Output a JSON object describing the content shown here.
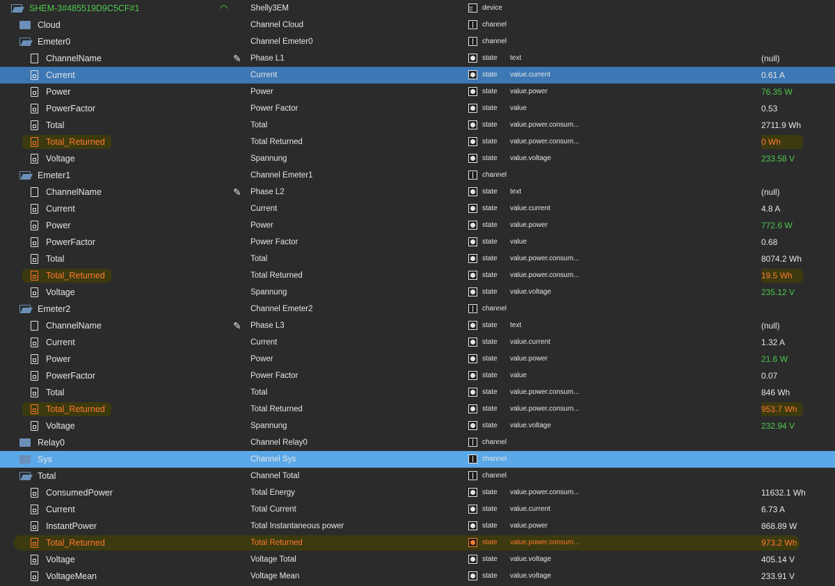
{
  "rows": [
    {
      "indent": 0,
      "icon": "folder-open",
      "name": "SHEM-3#485519D9C5CF#1",
      "name_color": "green",
      "wifi": true,
      "display": "Shelly3EM",
      "type": "device",
      "type_label": "device",
      "role": "",
      "value": ""
    },
    {
      "indent": 1,
      "icon": "folder",
      "name": "Cloud",
      "display": "Channel Cloud",
      "type": "channel",
      "type_label": "channel",
      "role": "",
      "value": ""
    },
    {
      "indent": 1,
      "icon": "folder-open",
      "name": "Emeter0",
      "display": "Channel Emeter0",
      "type": "channel",
      "type_label": "channel",
      "role": "",
      "value": ""
    },
    {
      "indent": 2,
      "icon": "doc",
      "name": "ChannelName",
      "edit": true,
      "display": "Phase L1",
      "type": "state",
      "type_label": "state",
      "role": "text",
      "value": "(null)"
    },
    {
      "indent": 2,
      "icon": "doc-state",
      "name": "Current",
      "selected": "blue",
      "display": "Current",
      "type": "state",
      "type_label": "state",
      "role": "value.current",
      "value": "0.61 A"
    },
    {
      "indent": 2,
      "icon": "doc-state",
      "name": "Power",
      "display": "Power",
      "type": "state",
      "type_label": "state",
      "role": "value.power",
      "value": "76.35 W",
      "value_color": "green"
    },
    {
      "indent": 2,
      "icon": "doc-state",
      "name": "PowerFactor",
      "display": "Power Factor",
      "type": "state",
      "type_label": "state",
      "role": "value",
      "value": "0.53"
    },
    {
      "indent": 2,
      "icon": "doc-state",
      "name": "Total",
      "display": "Total",
      "type": "state",
      "type_label": "state",
      "role": "value.power.consum...",
      "value": "2711.9 Wh"
    },
    {
      "indent": 2,
      "icon": "doc-ret",
      "name": "Total_Returned",
      "returned": true,
      "display": "Total Returned",
      "type": "state",
      "type_label": "state",
      "role": "value.power.consum...",
      "value": "0 Wh",
      "value_color": "orange",
      "value_hl": true
    },
    {
      "indent": 2,
      "icon": "doc-state",
      "name": "Voltage",
      "display": "Spannung",
      "type": "state",
      "type_label": "state",
      "role": "value.voltage",
      "value": "233.58 V",
      "value_color": "green"
    },
    {
      "indent": 1,
      "icon": "folder-open",
      "name": "Emeter1",
      "display": "Channel Emeter1",
      "type": "channel",
      "type_label": "channel",
      "role": "",
      "value": ""
    },
    {
      "indent": 2,
      "icon": "doc",
      "name": "ChannelName",
      "edit": true,
      "display": "Phase L2",
      "type": "state",
      "type_label": "state",
      "role": "text",
      "value": "(null)"
    },
    {
      "indent": 2,
      "icon": "doc-state",
      "name": "Current",
      "display": "Current",
      "type": "state",
      "type_label": "state",
      "role": "value.current",
      "value": "4.8 A"
    },
    {
      "indent": 2,
      "icon": "doc-state",
      "name": "Power",
      "display": "Power",
      "type": "state",
      "type_label": "state",
      "role": "value.power",
      "value": "772.6 W",
      "value_color": "green"
    },
    {
      "indent": 2,
      "icon": "doc-state",
      "name": "PowerFactor",
      "display": "Power Factor",
      "type": "state",
      "type_label": "state",
      "role": "value",
      "value": "0.68"
    },
    {
      "indent": 2,
      "icon": "doc-state",
      "name": "Total",
      "display": "Total",
      "type": "state",
      "type_label": "state",
      "role": "value.power.consum...",
      "value": "8074.2 Wh"
    },
    {
      "indent": 2,
      "icon": "doc-ret",
      "name": "Total_Returned",
      "returned": true,
      "display": "Total Returned",
      "type": "state",
      "type_label": "state",
      "role": "value.power.consum...",
      "value": "19.5 Wh",
      "value_color": "orange",
      "value_hl": true
    },
    {
      "indent": 2,
      "icon": "doc-state",
      "name": "Voltage",
      "display": "Spannung",
      "type": "state",
      "type_label": "state",
      "role": "value.voltage",
      "value": "235.12 V",
      "value_color": "green"
    },
    {
      "indent": 1,
      "icon": "folder-open",
      "name": "Emeter2",
      "display": "Channel Emeter2",
      "type": "channel",
      "type_label": "channel",
      "role": "",
      "value": ""
    },
    {
      "indent": 2,
      "icon": "doc",
      "name": "ChannelName",
      "edit": true,
      "display": "Phase L3",
      "type": "state",
      "type_label": "state",
      "role": "text",
      "value": "(null)"
    },
    {
      "indent": 2,
      "icon": "doc-state",
      "name": "Current",
      "display": "Current",
      "type": "state",
      "type_label": "state",
      "role": "value.current",
      "value": "1.32 A"
    },
    {
      "indent": 2,
      "icon": "doc-state",
      "name": "Power",
      "display": "Power",
      "type": "state",
      "type_label": "state",
      "role": "value.power",
      "value": "21.6 W",
      "value_color": "green"
    },
    {
      "indent": 2,
      "icon": "doc-state",
      "name": "PowerFactor",
      "display": "Power Factor",
      "type": "state",
      "type_label": "state",
      "role": "value",
      "value": "0.07"
    },
    {
      "indent": 2,
      "icon": "doc-state",
      "name": "Total",
      "display": "Total",
      "type": "state",
      "type_label": "state",
      "role": "value.power.consum...",
      "value": "846 Wh"
    },
    {
      "indent": 2,
      "icon": "doc-ret",
      "name": "Total_Returned",
      "returned": true,
      "display": "Total Returned",
      "type": "state",
      "type_label": "state",
      "role": "value.power.consum...",
      "value": "953.7 Wh",
      "value_color": "orange",
      "value_hl": true
    },
    {
      "indent": 2,
      "icon": "doc-state",
      "name": "Voltage",
      "display": "Spannung",
      "type": "state",
      "type_label": "state",
      "role": "value.voltage",
      "value": "232.94 V",
      "value_color": "green"
    },
    {
      "indent": 1,
      "icon": "folder",
      "name": "Relay0",
      "display": "Channel Relay0",
      "type": "channel",
      "type_label": "channel",
      "role": "",
      "value": ""
    },
    {
      "indent": 1,
      "icon": "folder",
      "name": "Sys",
      "selected": "light",
      "display": "Channel Sys",
      "type": "channel",
      "type_label": "channel",
      "role": "",
      "value": ""
    },
    {
      "indent": 1,
      "icon": "folder-open",
      "name": "Total",
      "display": "Channel Total",
      "type": "channel",
      "type_label": "channel",
      "role": "",
      "value": ""
    },
    {
      "indent": 2,
      "icon": "doc-state",
      "name": "ConsumedPower",
      "display": "Total Energy",
      "type": "state",
      "type_label": "state",
      "role": "value.power.consum...",
      "value": "11632.1 Wh"
    },
    {
      "indent": 2,
      "icon": "doc-state",
      "name": "Current",
      "display": "Total Current",
      "type": "state",
      "type_label": "state",
      "role": "value.current",
      "value": "6.73 A"
    },
    {
      "indent": 2,
      "icon": "doc-state",
      "name": "InstantPower",
      "display": "Total Instantaneous power",
      "type": "state",
      "type_label": "state",
      "role": "value.power",
      "value": "868.89 W"
    },
    {
      "indent": 2,
      "icon": "doc-ret",
      "name": "Total_Returned",
      "returned": true,
      "row_band": true,
      "display": "Total Returned",
      "type": "state",
      "type_label": "state",
      "role": "value.power.consum...",
      "value": "973.2 Wh",
      "value_color": "orange"
    },
    {
      "indent": 2,
      "icon": "doc-state",
      "name": "Voltage",
      "display": "Voltage Total",
      "type": "state",
      "type_label": "state",
      "role": "value.voltage",
      "value": "405.14 V"
    },
    {
      "indent": 2,
      "icon": "doc-state",
      "name": "VoltageMean",
      "display": "Voltage Mean",
      "type": "state",
      "type_label": "state",
      "role": "value.voltage",
      "value": "233.91 V"
    }
  ],
  "colors": {
    "green": "#4ec94e",
    "orange": "#ff7a2e",
    "selected": "#3d78b5",
    "selected_light": "#5aa8e8",
    "highlight": "#3c3a0f"
  },
  "icons": {
    "wifi": "wifi-icon",
    "edit": "edit-icon"
  }
}
